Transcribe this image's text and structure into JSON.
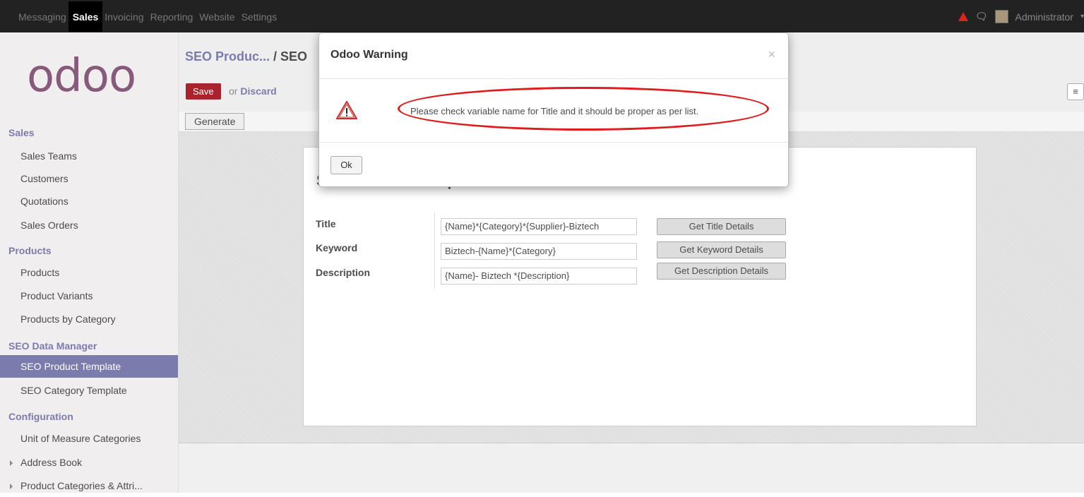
{
  "topbar": {
    "menu": [
      "Messaging",
      "Sales",
      "Invoicing",
      "Reporting",
      "Website",
      "Settings"
    ],
    "active": "Sales",
    "user": "Administrator"
  },
  "logo": "odoo",
  "sidebar": {
    "sections": [
      {
        "title": "Sales",
        "items": [
          "Sales Teams",
          "Customers",
          "Quotations",
          "Sales Orders"
        ]
      },
      {
        "title": "Products",
        "items": [
          "Products",
          "Product Variants",
          "Products by Category"
        ]
      },
      {
        "title": "SEO Data Manager",
        "items": [
          "SEO Product Template",
          "SEO Category Template"
        ]
      },
      {
        "title": "Configuration",
        "items": [
          "Unit of Measure Categories",
          "Address Book",
          "Product Categories & Attri..."
        ]
      }
    ],
    "active_item": "SEO Product Template"
  },
  "control_panel": {
    "breadcrumb_link": "SEO Produc...",
    "breadcrumb_current": "/ SEO",
    "save_label": "Save",
    "or_label": "or",
    "discard_label": "Discard",
    "generate_label": "Generate"
  },
  "form": {
    "heading": "SEO Product Template",
    "fields": [
      {
        "label": "Title",
        "value": "{Name}*{Category}*{Supplier}-Biztech",
        "button": "Get Title Details"
      },
      {
        "label": "Keyword",
        "value": "Biztech-{Name}*{Category}",
        "button": "Get Keyword Details"
      },
      {
        "label": "Description",
        "value": "{Name}- Biztech *{Description}",
        "button": "Get Description Details"
      }
    ]
  },
  "modal": {
    "title": "Odoo Warning",
    "close": "×",
    "message": "Please check variable name for Title and it should be proper as per list.",
    "ok_label": "Ok"
  },
  "colors": {
    "brand": "#875a7b",
    "accent": "#7c7bad",
    "save": "#a8232b",
    "annotation": "#e01b1b"
  }
}
